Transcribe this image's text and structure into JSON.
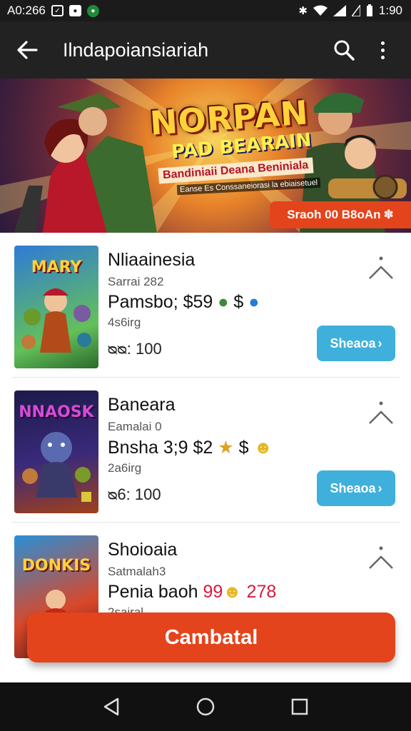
{
  "status": {
    "time_left": "A0:266",
    "time_right": "1:90"
  },
  "app_bar": {
    "title": "Ilndapoiansiariah"
  },
  "banner": {
    "title": "NORPAN",
    "subtitle": "PAD BEARAIN",
    "line1": "Bandiniaii Deana Beniniala",
    "line2": "Eanse Es Conssaneiorasi la ebiaisetuel",
    "cta": "Sraoh 00 B8oAn"
  },
  "items": [
    {
      "thumb_title": "MARY",
      "name": "Nliaainesia",
      "sub": "Sarrai 282",
      "price_text": "Pamsbo; $59",
      "price_suffix": "$",
      "meta": "4s6irg",
      "rating": "ᴓᴓ: 100",
      "button": "Sheaoa",
      "thumb_colors": [
        "#2f7bd6",
        "#63c05a"
      ]
    },
    {
      "thumb_title": "NNAOSK",
      "name": "Baneara",
      "sub": "Eamalai 0",
      "price_text": "Bnsha 3;9 $2",
      "price_suffix": "$",
      "meta": "2a6irg",
      "rating": "ᴓ6: 100",
      "button": "Sheaoa",
      "thumb_colors": [
        "#1c1a4a",
        "#7a3aa0"
      ]
    },
    {
      "thumb_title": "DONKIS",
      "name": "Shoioaia",
      "sub": "Satmalah3",
      "price_text": "Penia baoh",
      "price_red": "99",
      "price_red2": "278",
      "meta": "2sairal",
      "thumb_colors": [
        "#d8482a",
        "#2a8fd6"
      ]
    }
  ],
  "fab": {
    "label": "Cambatal"
  },
  "colors": {
    "accent": "#e4441c",
    "button_blue": "#3fb0db",
    "bar": "#222222"
  }
}
